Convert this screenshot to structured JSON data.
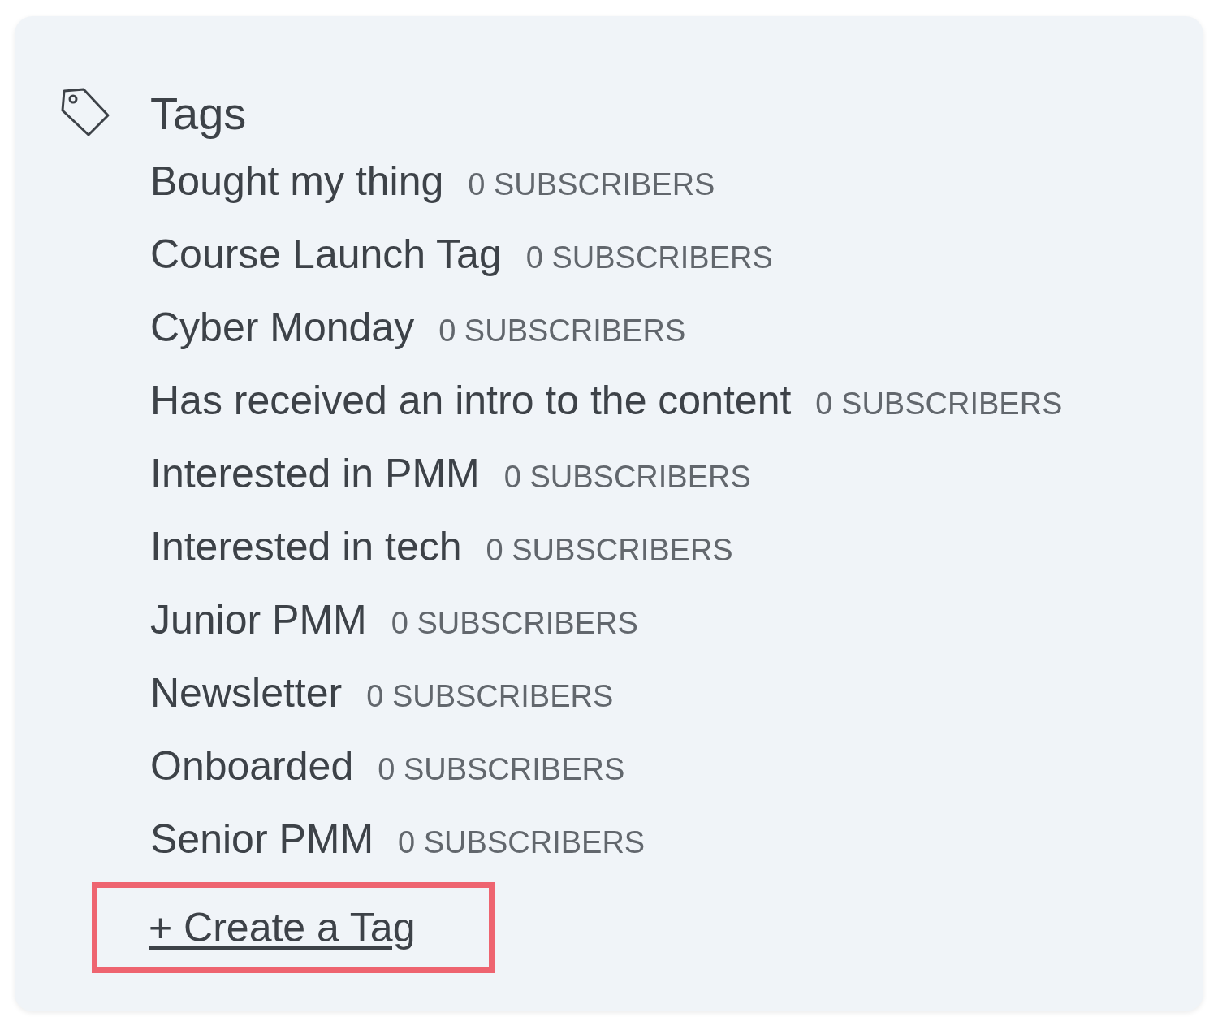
{
  "title": "Tags",
  "tags": [
    {
      "name": "Bought my thing",
      "count": "0 SUBSCRIBERS"
    },
    {
      "name": "Course Launch Tag",
      "count": "0 SUBSCRIBERS"
    },
    {
      "name": "Cyber Monday",
      "count": "0 SUBSCRIBERS"
    },
    {
      "name": "Has received an intro to the content",
      "count": "0 SUBSCRIBERS"
    },
    {
      "name": "Interested in PMM",
      "count": "0 SUBSCRIBERS"
    },
    {
      "name": "Interested in tech",
      "count": "0 SUBSCRIBERS"
    },
    {
      "name": "Junior PMM",
      "count": "0 SUBSCRIBERS"
    },
    {
      "name": "Newsletter",
      "count": "0 SUBSCRIBERS"
    },
    {
      "name": "Onboarded",
      "count": "0 SUBSCRIBERS"
    },
    {
      "name": "Senior PMM",
      "count": "0 SUBSCRIBERS"
    }
  ],
  "create_link": {
    "label": "+ Create a Tag",
    "highlighted": true
  }
}
